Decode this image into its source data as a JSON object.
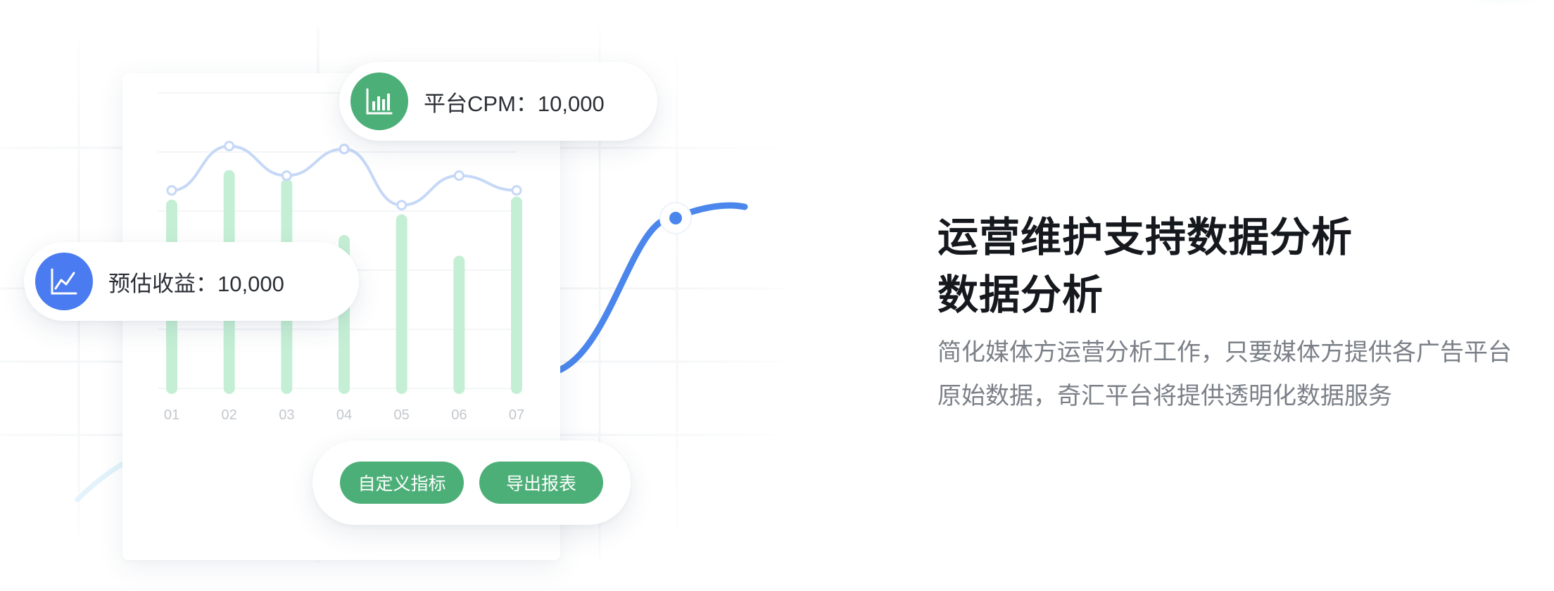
{
  "colors": {
    "accent_green": "#4daf78",
    "bar_green": "#c5efd5",
    "curve_blue": "#4b86ec",
    "line_light_blue": "#c6d8f7",
    "icon_blue": "#4b7bf0",
    "title": "#15181d",
    "desc": "#7b8088"
  },
  "cpm_badge": {
    "icon": "bar-chart-icon",
    "label": "平台CPM：10,000"
  },
  "income_badge": {
    "icon": "line-chart-icon",
    "label": "预估收益：10,000"
  },
  "actions": {
    "custom_label": "自定义指标",
    "export_label": "导出报表"
  },
  "chart_data": {
    "type": "bar",
    "categories": [
      "01",
      "02",
      "03",
      "04",
      "05",
      "06",
      "07"
    ],
    "series": [
      {
        "type": "bar",
        "values": [
          6.2,
          7.2,
          6.9,
          5.0,
          5.7,
          4.3,
          6.3
        ]
      },
      {
        "type": "line",
        "values": [
          6.7,
          8.2,
          7.2,
          8.1,
          6.2,
          7.2,
          6.7
        ]
      }
    ],
    "ylim": [
      0,
      10
    ],
    "grid": true
  },
  "content": {
    "title_line1": "运营维护支持数据分析",
    "title_line2": "数据分析",
    "description": "简化媒体方运营分析工作，只要媒体方提供各广告平台 原始数据，奇汇平台将提供透明化数据服务"
  }
}
